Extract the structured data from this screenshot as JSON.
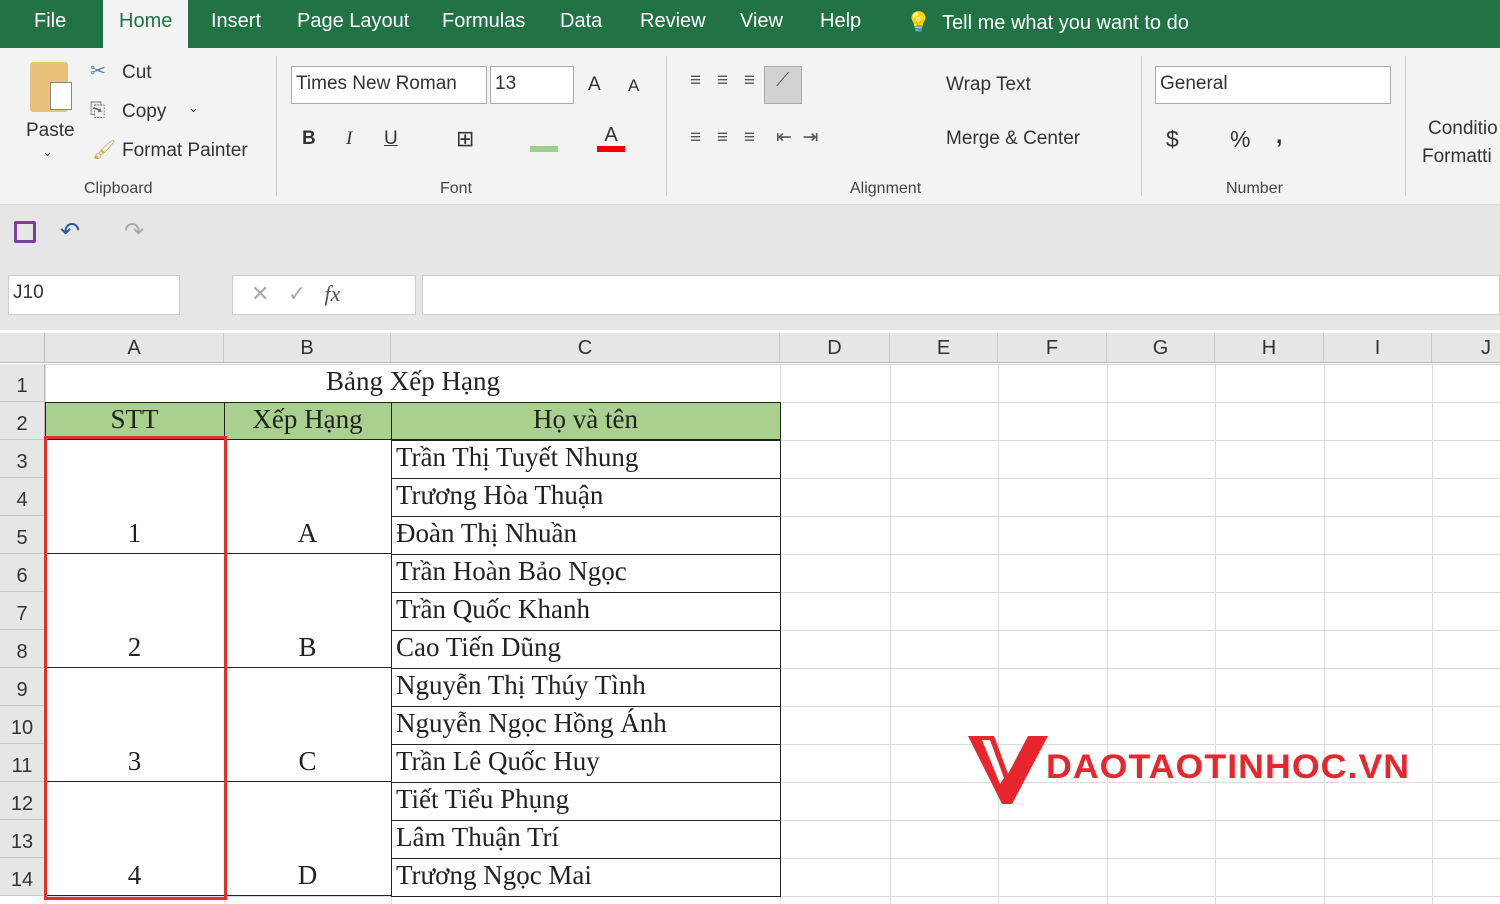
{
  "tabs": [
    "File",
    "Home",
    "Insert",
    "Page Layout",
    "Formulas",
    "Data",
    "Review",
    "View",
    "Help"
  ],
  "tell_me": "Tell me what you want to do",
  "clipboard": {
    "paste": "Paste",
    "cut": "Cut",
    "copy": "Copy",
    "format_painter": "Format Painter",
    "group": "Clipboard"
  },
  "font": {
    "name": "Times New Roman",
    "size": "13",
    "bold": "B",
    "italic": "I",
    "underline": "U",
    "group": "Font"
  },
  "alignment": {
    "wrap_text": "Wrap Text",
    "merge_center": "Merge & Center",
    "group": "Alignment"
  },
  "number": {
    "format": "General",
    "currency": "$",
    "percent": "%",
    "comma": ",",
    "group": "Number"
  },
  "styles": {
    "conditional_formatting_1": "Conditio",
    "conditional_formatting_2": "Formatti"
  },
  "name_box": "J10",
  "formula_value": "",
  "columns": [
    "A",
    "B",
    "C",
    "D",
    "E",
    "F",
    "G",
    "H",
    "I",
    "J"
  ],
  "rows": [
    "1",
    "2",
    "3",
    "4",
    "5",
    "6",
    "7",
    "8",
    "9",
    "10",
    "11",
    "12",
    "13",
    "14"
  ],
  "sheet": {
    "title": "Bảng Xếp Hạng",
    "headers": [
      "STT",
      "Xếp Hạng",
      "Họ và tên"
    ],
    "groups": [
      {
        "stt": "1",
        "rank": "A",
        "names": [
          "Trần Thị Tuyết Nhung",
          "Trương Hòa Thuận",
          "Đoàn Thị Nhuần"
        ]
      },
      {
        "stt": "2",
        "rank": "B",
        "names": [
          "Trần Hoàn Bảo Ngọc",
          "Trần Quốc Khanh",
          "Cao Tiến Dũng"
        ]
      },
      {
        "stt": "3",
        "rank": "C",
        "names": [
          "Nguyễn Thị Thúy Tình",
          "Nguyễn Ngọc Hồng Ánh",
          "Trần Lê Quốc Huy"
        ]
      },
      {
        "stt": "4",
        "rank": "D",
        "names": [
          "Tiết Tiểu Phụng",
          "Lâm Thuận Trí",
          "Trương Ngọc Mai"
        ]
      }
    ]
  },
  "watermark": "DAOTAOTINHOC.VN",
  "colors": {
    "excel_green": "#217346",
    "header_fill": "#a9d08e",
    "highlight_red": "#e03030",
    "logo_red": "#e8262d"
  }
}
